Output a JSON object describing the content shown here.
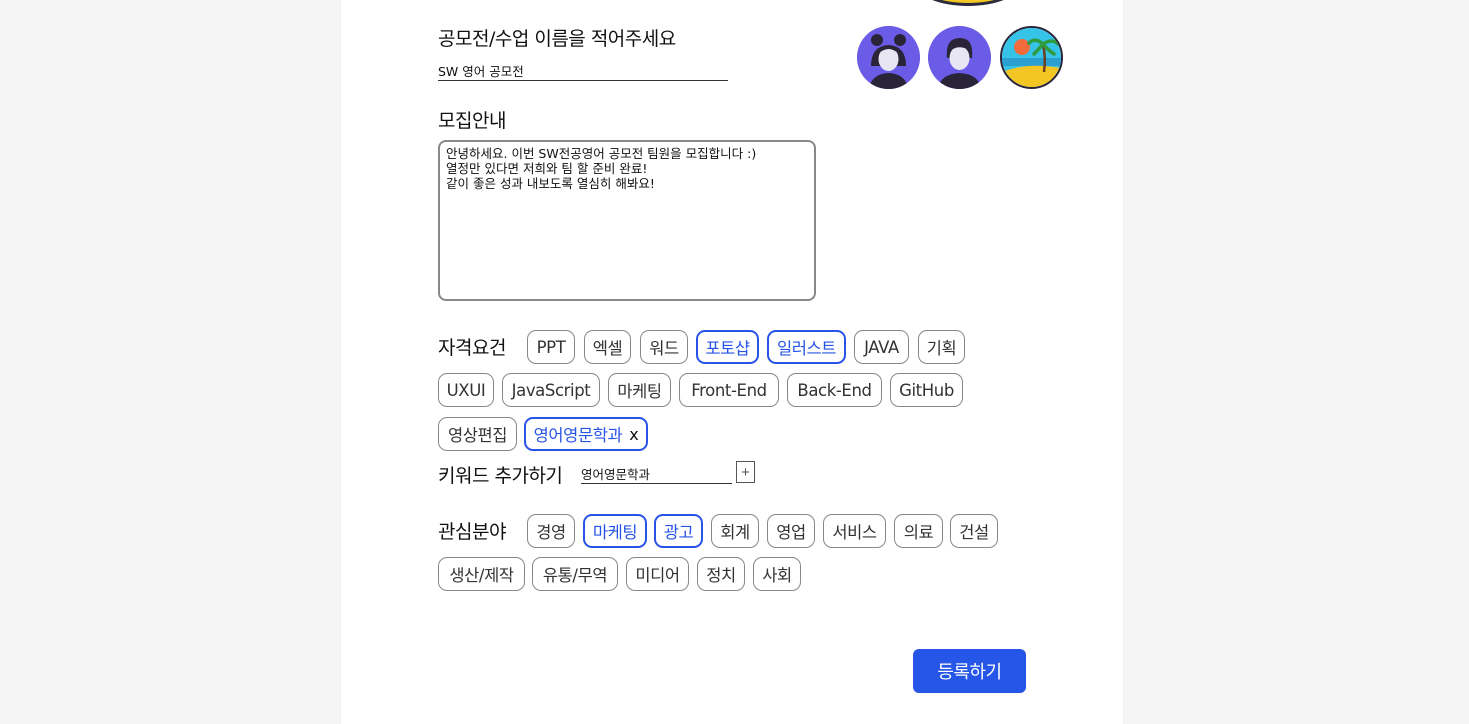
{
  "contest": {
    "name_label": "공모전/수업 이름을 적어주세요",
    "name_value": "SW 영어 공모전"
  },
  "recruit": {
    "label": "모집안내",
    "text": "안녕하세요. 이번 SW전공영어 공모전 팀원을 모집합니다 :)\n열정만 있다면 저희와 팀 할 준비 완료!\n같이 좋은 성과 내보도록 열심히 해봐요!"
  },
  "avatars": [
    {
      "name": "girl-avatar",
      "bg": "#6b5ce7"
    },
    {
      "name": "boy-avatar",
      "bg": "#6b5ce7"
    },
    {
      "name": "beach-avatar",
      "bg": "#35c3e8"
    }
  ],
  "qualifications": {
    "label": "자격요건",
    "chips": [
      {
        "text": "PPT",
        "selected": false
      },
      {
        "text": "엑셀",
        "selected": false
      },
      {
        "text": "워드",
        "selected": false
      },
      {
        "text": "포토샵",
        "selected": true
      },
      {
        "text": "일러스트",
        "selected": true
      },
      {
        "text": "JAVA",
        "selected": false
      },
      {
        "text": "기획",
        "selected": false
      },
      {
        "text": "UXUI",
        "selected": false
      },
      {
        "text": "JavaScript",
        "selected": false
      },
      {
        "text": "마케팅",
        "selected": false
      },
      {
        "text": "Front-End",
        "selected": false
      },
      {
        "text": "Back-End",
        "selected": false
      },
      {
        "text": "GitHub",
        "selected": false
      },
      {
        "text": "영상편집",
        "selected": false
      },
      {
        "text": "영어영문학과",
        "selected": true,
        "removable": true,
        "remove_label": "x"
      }
    ]
  },
  "keyword": {
    "label": "키워드 추가하기",
    "value": "영어영문학과",
    "add_label": "+"
  },
  "interests": {
    "label": "관심분야",
    "chips": [
      {
        "text": "경영",
        "selected": false
      },
      {
        "text": "마케팅",
        "selected": true
      },
      {
        "text": "광고",
        "selected": true
      },
      {
        "text": "회계",
        "selected": false
      },
      {
        "text": "영업",
        "selected": false
      },
      {
        "text": "서비스",
        "selected": false
      },
      {
        "text": "의료",
        "selected": false
      },
      {
        "text": "건설",
        "selected": false
      },
      {
        "text": "생산/제작",
        "selected": false
      },
      {
        "text": "유통/무역",
        "selected": false
      },
      {
        "text": "미디어",
        "selected": false
      },
      {
        "text": "정치",
        "selected": false
      },
      {
        "text": "사회",
        "selected": false
      }
    ]
  },
  "submit_label": "등록하기",
  "colors": {
    "accent": "#2556e8",
    "selected_chip": "#2754e6",
    "chip_border": "#888888",
    "background": "#f5f5f5"
  }
}
